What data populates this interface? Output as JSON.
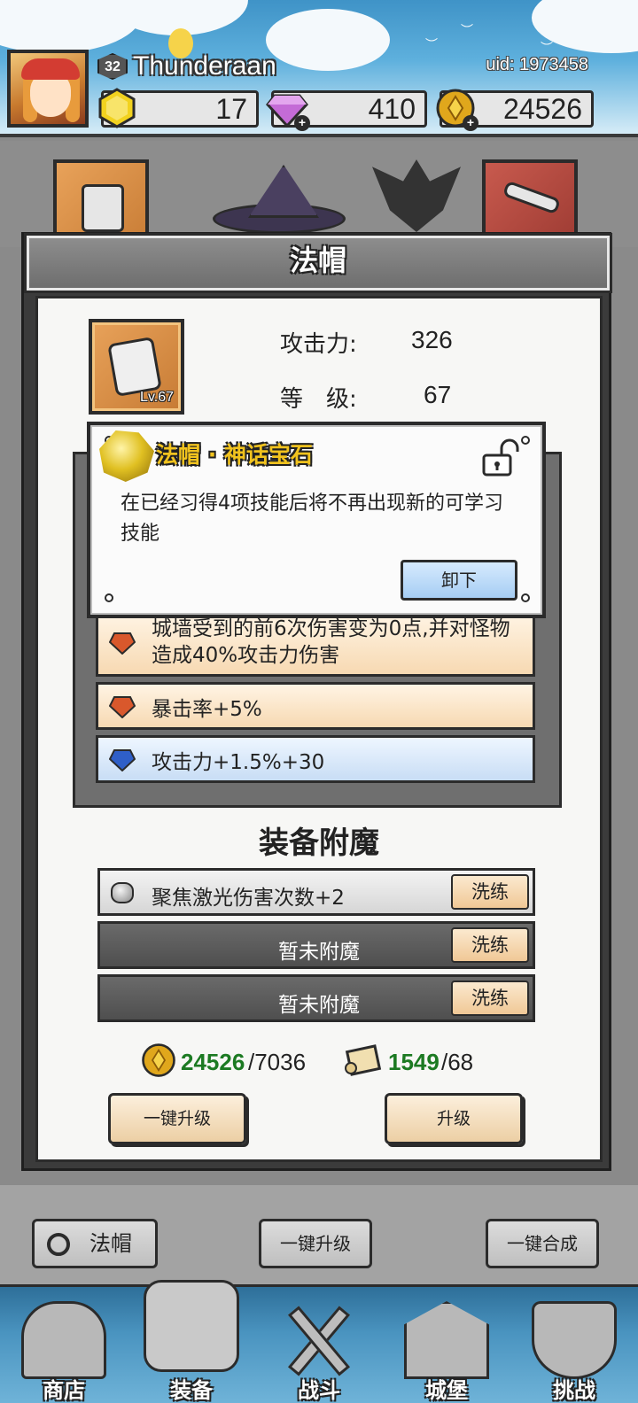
{
  "header": {
    "level": "32",
    "player_name": "Thunderaan",
    "uid": "uid: 1973458",
    "resources": [
      {
        "name": "gold-gem",
        "value": "17"
      },
      {
        "name": "diamond",
        "value": "410"
      },
      {
        "name": "coin",
        "value": "24526"
      }
    ]
  },
  "panel": {
    "title": "法帽",
    "item_level": "Lv.67",
    "stats": [
      {
        "label": "攻击力:",
        "value": "326"
      },
      {
        "label": "等　级:",
        "value": "67"
      }
    ]
  },
  "popup": {
    "title": "法帽 · 神话宝石",
    "description": "在已经习得4项技能后将不再出现新的可学习技能",
    "unequip_label": "卸下"
  },
  "gems": [
    {
      "text": "城墙受到的前6次伤害变为0点,并对怪物造成40%攻击力伤害",
      "color": "orange"
    },
    {
      "text": "暴击率+5%",
      "color": "orange"
    },
    {
      "text": "攻击力+1.5%+30",
      "color": "blue"
    }
  ],
  "enchant": {
    "title": "装备附魔",
    "reroll_label": "洗练",
    "rows": [
      {
        "text": "聚焦激光伤害次数+2"
      },
      {
        "text": "暂未附魔"
      },
      {
        "text": "暂未附魔"
      }
    ]
  },
  "costs": {
    "coin_have": "24526",
    "coin_need": "/7036",
    "scroll_have": "1549",
    "scroll_need": "/68"
  },
  "buttons": {
    "one_click_upgrade": "一键升级",
    "upgrade": "升级"
  },
  "bottom": {
    "category_label": "法帽",
    "one_click_upgrade": "一键升级",
    "one_click_merge": "一键合成"
  },
  "nav": [
    {
      "label": "商店"
    },
    {
      "label": "装备"
    },
    {
      "label": "战斗"
    },
    {
      "label": "城堡"
    },
    {
      "label": "挑战"
    }
  ],
  "colors": {
    "accent_gold": "#f1c31e",
    "have_green": "#1c7a22",
    "unequip_blue": "#a6cdf3"
  }
}
